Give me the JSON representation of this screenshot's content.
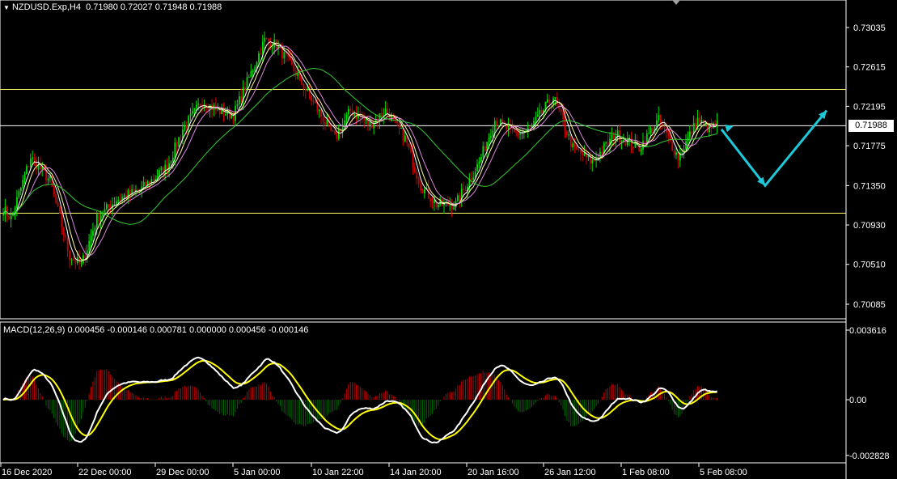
{
  "header": {
    "symbol_timeframe": "NZDUSD.Exp,H4",
    "ohlc": "0.71980 0.72027 0.71948 0.71988"
  },
  "macd_header": "MACD(12,26,9) 0.000456 -0.000146 0.000781 0.000000 0.000456 -0.000146",
  "current_price_label": "0.71988",
  "colors": {
    "background": "#000000",
    "bull_candle": "#00e000",
    "bear_candle": "#d00000",
    "grid_frame": "#ffffff",
    "level_line": "#ffff66",
    "ma_white": "#ffffff",
    "ma_yellow": "#ffff99",
    "ma_pink": "#dd88dd",
    "ma_green": "#33cc33",
    "forecast_arrow": "#1fc8d8",
    "macd_line": "#ffffff",
    "signal_line": "#ffff00",
    "hist_pos": "#c00000",
    "hist_neg": "#006600"
  },
  "chart_data": [
    {
      "type": "candlestick",
      "title": "NZDUSD.Exp,H4",
      "ylim": [
        0.6995,
        0.7338
      ],
      "price_ticks": [
        "0.73035",
        "0.72615",
        "0.72195",
        "0.71775",
        "0.71350",
        "0.70930",
        "0.70510",
        "0.70085"
      ],
      "time_labels": [
        "16 Dec 2020",
        "22 Dec 00:00",
        "29 Dec 00:00",
        "5 Jan 00:00",
        "10 Jan 22:00",
        "14 Jan 20:00",
        "20 Jan 16:00",
        "26 Jan 12:00",
        "1 Feb 08:00",
        "5 Feb 08:00"
      ],
      "horizontal_levels": [
        0.72375,
        0.71988,
        0.71055
      ],
      "price_path_anchors": [
        [
          0,
          0.711
        ],
        [
          4,
          0.71
        ],
        [
          14,
          0.7165
        ],
        [
          24,
          0.714
        ],
        [
          34,
          0.706
        ],
        [
          40,
          0.705
        ],
        [
          48,
          0.71
        ],
        [
          58,
          0.712
        ],
        [
          70,
          0.713
        ],
        [
          84,
          0.7155
        ],
        [
          92,
          0.7195
        ],
        [
          102,
          0.7225
        ],
        [
          110,
          0.7215
        ],
        [
          118,
          0.721
        ],
        [
          126,
          0.725
        ],
        [
          134,
          0.729
        ],
        [
          140,
          0.7285
        ],
        [
          150,
          0.7255
        ],
        [
          160,
          0.722
        ],
        [
          170,
          0.7185
        ],
        [
          178,
          0.7215
        ],
        [
          188,
          0.72
        ],
        [
          196,
          0.7215
        ],
        [
          206,
          0.7185
        ],
        [
          214,
          0.7135
        ],
        [
          222,
          0.7115
        ],
        [
          232,
          0.7115
        ],
        [
          244,
          0.716
        ],
        [
          252,
          0.7205
        ],
        [
          262,
          0.719
        ],
        [
          270,
          0.7195
        ],
        [
          282,
          0.723
        ],
        [
          292,
          0.7175
        ],
        [
          302,
          0.716
        ],
        [
          314,
          0.719
        ],
        [
          326,
          0.7175
        ],
        [
          336,
          0.7205
        ],
        [
          346,
          0.7165
        ],
        [
          356,
          0.7205
        ],
        [
          362,
          0.7195
        ],
        [
          366,
          0.72
        ]
      ],
      "forecast_path": [
        [
          0.7195,
          0
        ],
        [
          0.7135,
          1
        ],
        [
          0.7215,
          2
        ]
      ],
      "moving_averages": [
        "ma_white",
        "ma_yellow",
        "ma_pink",
        "ma_green"
      ]
    },
    {
      "type": "macd",
      "title": "MACD(12,26,9)",
      "ylim": [
        -0.003,
        0.0038
      ],
      "ticks": [
        "0.003616",
        "0.00",
        "-0.002828"
      ],
      "values": {
        "macd": 0.000456,
        "signal": -0.000146,
        "histogram": 0.000781
      }
    }
  ]
}
